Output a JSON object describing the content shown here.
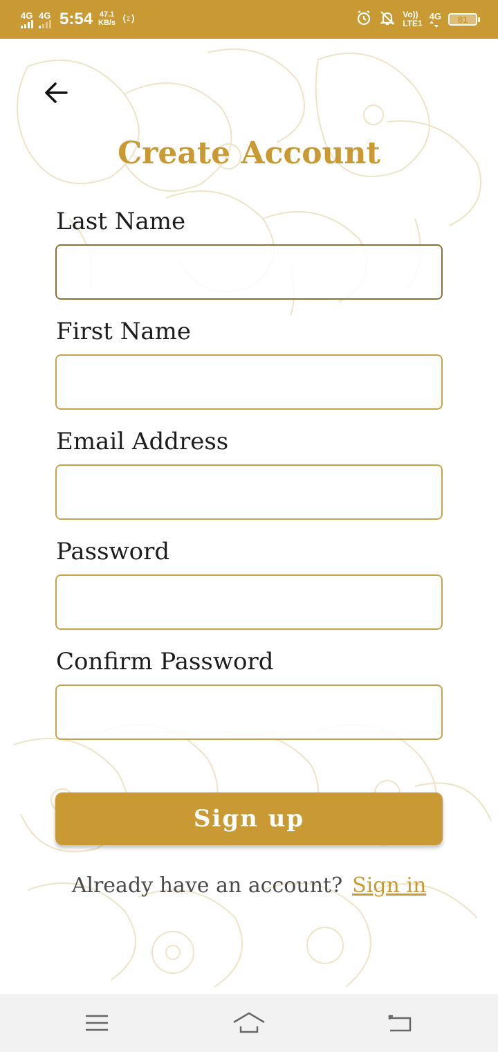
{
  "status_bar": {
    "net1": "4G",
    "net2": "4G",
    "time": "5:54",
    "speed_value": "47.1",
    "speed_unit": "KB/s",
    "volte_top": "Vo))",
    "volte_bottom": "LTE1",
    "net3": "4G",
    "battery": "81"
  },
  "screen": {
    "title": "Create Account"
  },
  "form": {
    "fields": [
      {
        "label": "Last Name",
        "value": ""
      },
      {
        "label": "First Name",
        "value": ""
      },
      {
        "label": "Email Address",
        "value": ""
      },
      {
        "label": "Password",
        "value": ""
      },
      {
        "label": "Confirm Password",
        "value": ""
      }
    ],
    "submit_label": "Sign up"
  },
  "footer": {
    "prompt": "Already have an account?",
    "link": "Sign in"
  },
  "colors": {
    "accent": "#c99a34",
    "floral": "#efe3c8"
  },
  "icons": {
    "back": "arrow-left-icon",
    "nav_menu": "menu-icon",
    "nav_home": "home-icon",
    "nav_back": "back-icon"
  }
}
